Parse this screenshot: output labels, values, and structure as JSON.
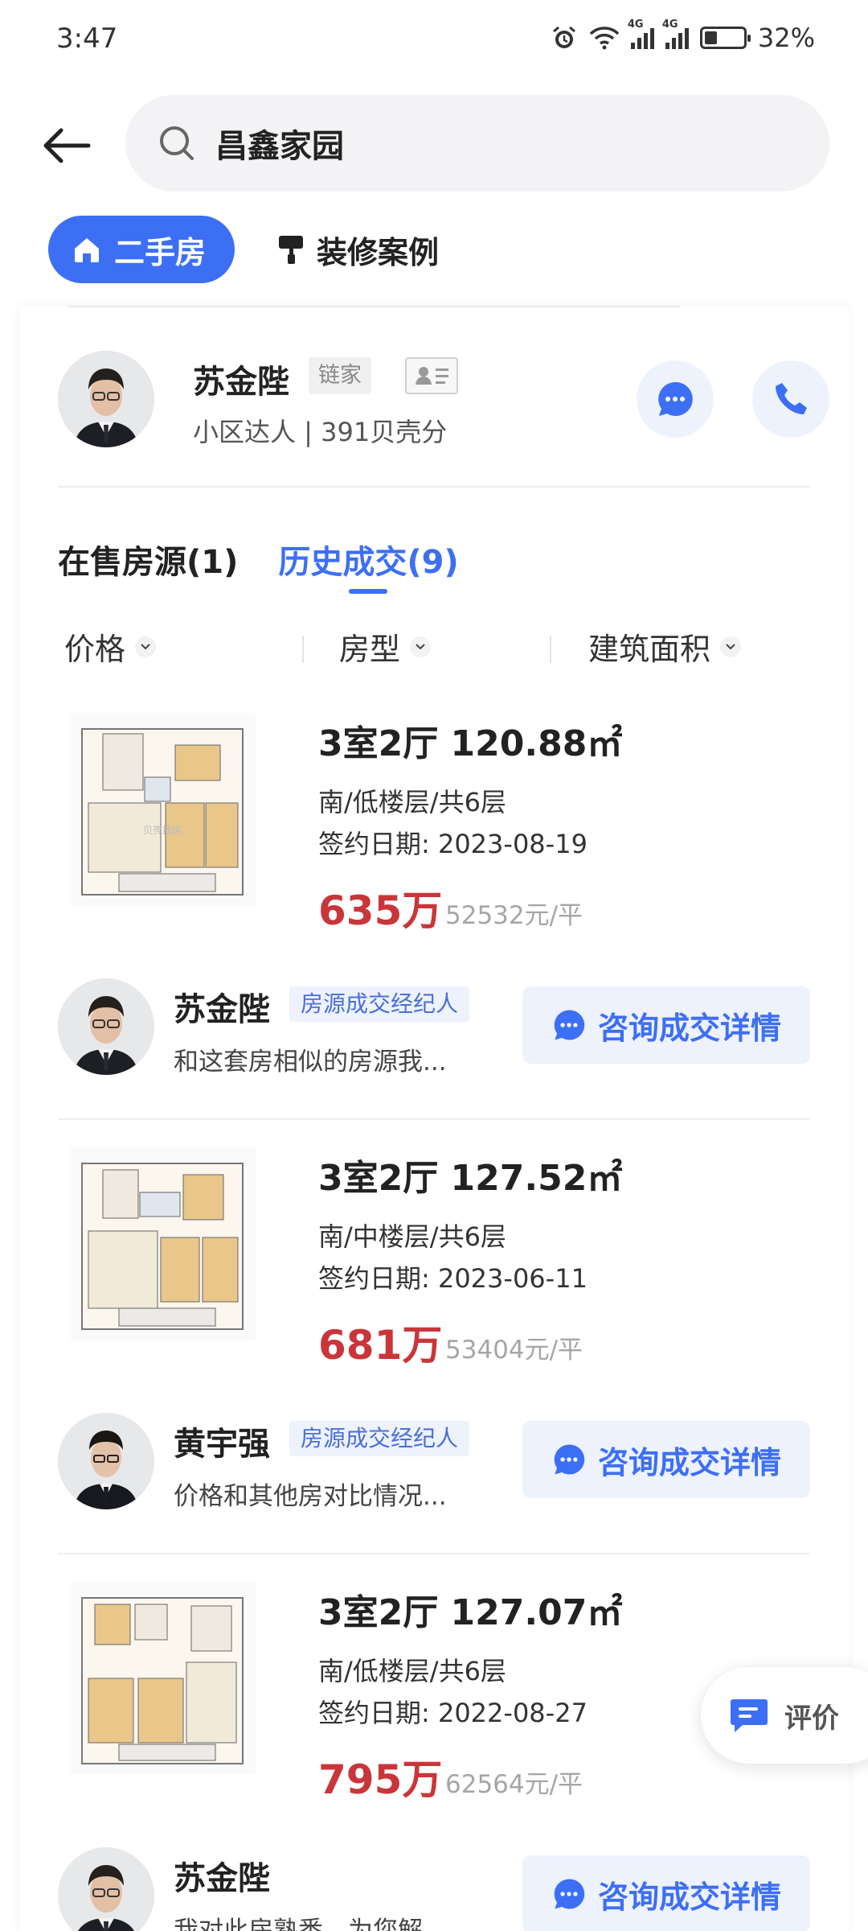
{
  "status": {
    "time": "3:47",
    "battery_label": "32%",
    "battery_level": 0.32
  },
  "search": {
    "query": "昌鑫家园"
  },
  "top_tabs": [
    {
      "label": "二手房",
      "active": true
    },
    {
      "label": "装修案例",
      "active": false
    }
  ],
  "agent": {
    "name": "苏金陛",
    "brand": "链家",
    "subtitle": "小区达人 | 391贝壳分"
  },
  "section_tabs": [
    {
      "label": "在售房源(1)",
      "active": false
    },
    {
      "label": "历史成交(9)",
      "active": true
    }
  ],
  "filters": [
    {
      "label": "价格"
    },
    {
      "label": "房型"
    },
    {
      "label": "建筑面积"
    }
  ],
  "listings": [
    {
      "title": "3室2厅 120.88㎡",
      "floor": "南/低楼层/共6层",
      "date": "签约日期: 2023-08-19",
      "price": "635万",
      "unit_price": "52532元/平",
      "agent_name": "苏金陛",
      "agent_role": "房源成交经纪人",
      "agent_desc": "和这套房相似的房源我...",
      "consult_label": "咨询成交详情"
    },
    {
      "title": "3室2厅 127.52㎡",
      "floor": "南/中楼层/共6层",
      "date": "签约日期: 2023-06-11",
      "price": "681万",
      "unit_price": "53404元/平",
      "agent_name": "黄宇强",
      "agent_role": "房源成交经纪人",
      "agent_desc": "价格和其他房对比情况...",
      "consult_label": "咨询成交详情"
    },
    {
      "title": "3室2厅 127.07㎡",
      "floor": "南/低楼层/共6层",
      "date": "签约日期: 2022-08-27",
      "price": "795万",
      "unit_price": "62564元/平",
      "agent_name": "苏金陛",
      "agent_role": "",
      "agent_desc": "我对此房熟悉，为您解...",
      "consult_label": "咨询成交详情"
    }
  ],
  "fab": {
    "label": "评价"
  },
  "colors": {
    "accent": "#3d6ff5",
    "price": "#c9363a"
  }
}
